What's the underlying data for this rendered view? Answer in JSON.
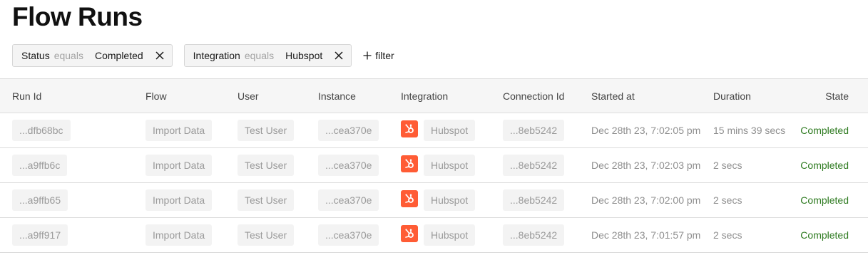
{
  "page": {
    "title": "Flow Runs"
  },
  "filters": [
    {
      "field": "Status",
      "operator": "equals",
      "value": "Completed"
    },
    {
      "field": "Integration",
      "operator": "equals",
      "value": "Hubspot"
    }
  ],
  "add_filter_label": "filter",
  "columns": [
    "Run Id",
    "Flow",
    "User",
    "Instance",
    "Integration",
    "Connection Id",
    "Started at",
    "Duration",
    "State"
  ],
  "rows": [
    {
      "run_id": "...dfb68bc",
      "flow": "Import Data",
      "user": "Test User",
      "instance": "...cea370e",
      "integration": "Hubspot",
      "connection_id": "...8eb5242",
      "started_at": "Dec 28th 23, 7:02:05 pm",
      "duration": "15 mins 39 secs",
      "state": "Completed"
    },
    {
      "run_id": "...a9ffb6c",
      "flow": "Import Data",
      "user": "Test User",
      "instance": "...cea370e",
      "integration": "Hubspot",
      "connection_id": "...8eb5242",
      "started_at": "Dec 28th 23, 7:02:03 pm",
      "duration": "2 secs",
      "state": "Completed"
    },
    {
      "run_id": "...a9ffb65",
      "flow": "Import Data",
      "user": "Test User",
      "instance": "...cea370e",
      "integration": "Hubspot",
      "connection_id": "...8eb5242",
      "started_at": "Dec 28th 23, 7:02:00 pm",
      "duration": "2 secs",
      "state": "Completed"
    },
    {
      "run_id": "...a9ff917",
      "flow": "Import Data",
      "user": "Test User",
      "instance": "...cea370e",
      "integration": "Hubspot",
      "connection_id": "...8eb5242",
      "started_at": "Dec 28th 23, 7:01:57 pm",
      "duration": "2 secs",
      "state": "Completed"
    }
  ],
  "icons": {
    "integration": "hubspot-logo-icon",
    "remove_filter": "close-icon",
    "add": "plus-icon"
  },
  "colors": {
    "hubspot": "#ff5c35",
    "completed": "#2d7a1f"
  }
}
